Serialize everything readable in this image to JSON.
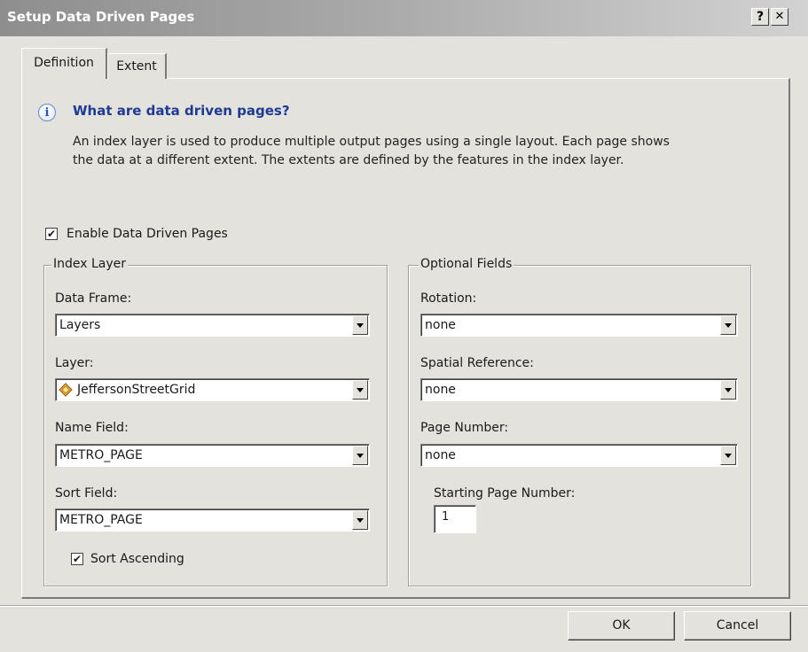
{
  "window": {
    "title": "Setup Data Driven Pages",
    "help_button": "?",
    "close_button": "✕"
  },
  "tabs": [
    {
      "label": "Definition",
      "active": true
    },
    {
      "label": "Extent",
      "active": false
    }
  ],
  "info": {
    "icon": "info-icon",
    "heading": "What are data driven pages?",
    "line1": "An index layer is used to produce multiple output pages using a single layout.  Each page shows",
    "line2": "the data at a different extent.  The extents are defined by the features in the index layer."
  },
  "enable_checkbox": {
    "label": "Enable Data Driven Pages",
    "checked": true
  },
  "index_layer": {
    "legend": "Index Layer",
    "data_frame": {
      "label": "Data Frame:",
      "value": "Layers"
    },
    "layer": {
      "label": "Layer:",
      "value": "JeffersonStreetGrid",
      "icon": "polygon-layer-icon"
    },
    "name_field": {
      "label": "Name Field:",
      "value": "METRO_PAGE"
    },
    "sort_field": {
      "label": "Sort Field:",
      "value": "METRO_PAGE"
    },
    "sort_ascending": {
      "label": "Sort Ascending",
      "checked": true
    }
  },
  "optional_fields": {
    "legend": "Optional Fields",
    "rotation": {
      "label": "Rotation:",
      "value": "none"
    },
    "spatial_reference": {
      "label": "Spatial Reference:",
      "value": "none"
    },
    "page_number": {
      "label": "Page Number:",
      "value": "none"
    },
    "starting_page_number": {
      "label": "Starting Page Number:",
      "value": "1"
    }
  },
  "buttons": {
    "ok": "OK",
    "cancel": "Cancel"
  }
}
